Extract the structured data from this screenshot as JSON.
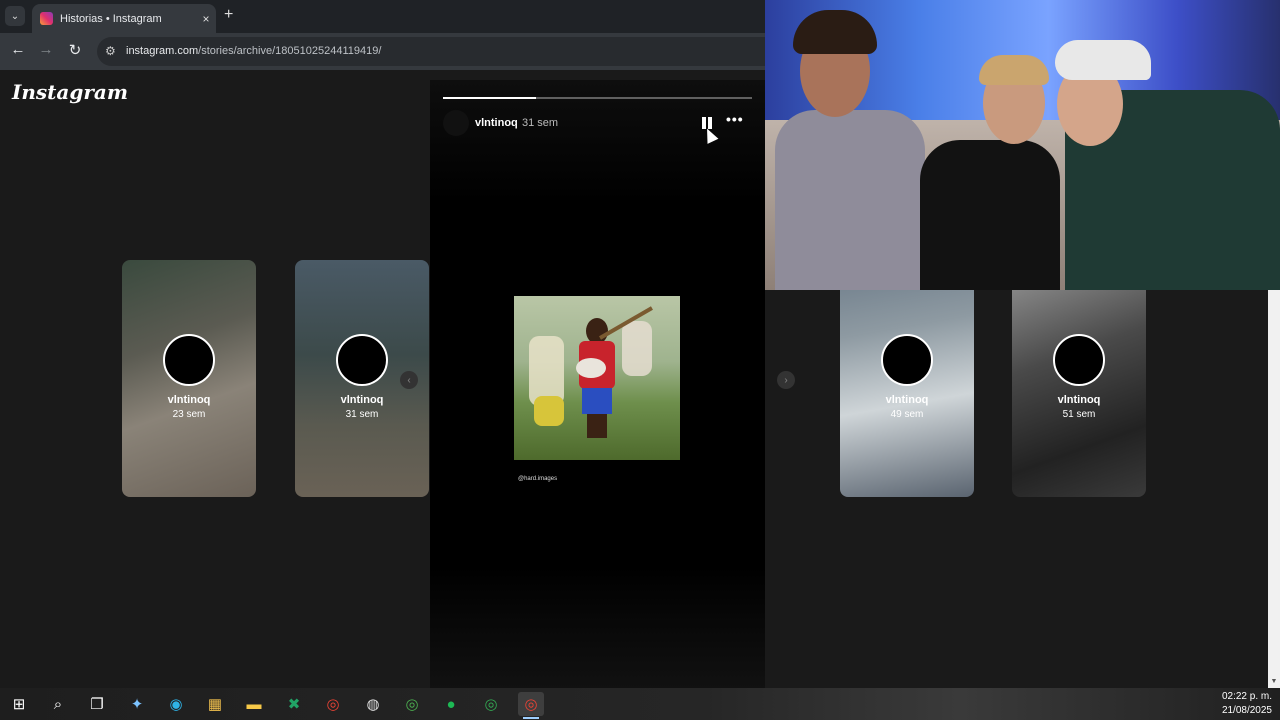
{
  "browser": {
    "tab_title": "Historias • Instagram",
    "new_tab_icon": "+",
    "close_icon": "×",
    "url_host": "instagram.com",
    "url_path": "/stories/archive/18051025244119419/"
  },
  "instagram": {
    "logo": "Instagram",
    "viewer": {
      "username": "vlntinoq",
      "time": "31 sem",
      "progress": 0.3,
      "more_label": "•••",
      "caption": "@hard.images"
    },
    "cards": [
      {
        "username": "vlntinoq",
        "time": "23 sem"
      },
      {
        "username": "vlntinoq",
        "time": "31 sem"
      },
      {
        "username": "vlntinoq",
        "time": "49 sem"
      },
      {
        "username": "vlntinoq",
        "time": "51 sem"
      }
    ]
  },
  "taskbar": {
    "apps": [
      "windows-start-icon",
      "search-icon",
      "task-view-icon",
      "copilot-icon",
      "edge-icon",
      "store-icon",
      "file-explorer-icon",
      "excel-icon",
      "chrome-icon",
      "obs-icon",
      "chrome-profile-icon",
      "spotify-icon",
      "chrome-profile-2-icon",
      "chrome-active-icon"
    ],
    "time": "02:22 p. m.",
    "date": "21/08/2025"
  }
}
